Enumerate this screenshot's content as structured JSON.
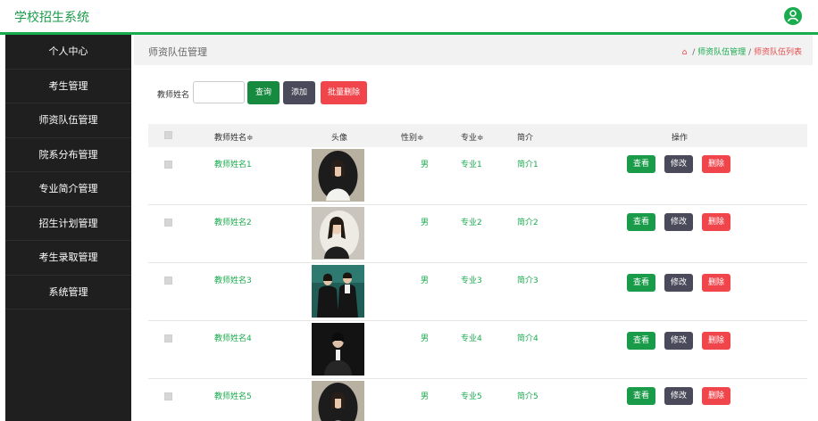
{
  "app": {
    "title": "学校招生系统"
  },
  "sidebar": {
    "items": [
      {
        "label": "个人中心"
      },
      {
        "label": "考生管理"
      },
      {
        "label": "师资队伍管理"
      },
      {
        "label": "院系分布管理"
      },
      {
        "label": "专业简介管理"
      },
      {
        "label": "招生计划管理"
      },
      {
        "label": "考生录取管理"
      },
      {
        "label": "系统管理"
      }
    ]
  },
  "header": {
    "page_title": "师资队伍管理",
    "breadcrumb": [
      "师资队伍管理",
      "师资队伍列表"
    ],
    "breadcrumb_sep": "/"
  },
  "search": {
    "label": "教师姓名",
    "value": "",
    "placeholder": "",
    "search_button": "查询",
    "add_button": "添加",
    "batch_delete_button": "批量删除"
  },
  "table": {
    "columns": {
      "name": "教师姓名≑",
      "photo": "头像",
      "gender": "性别≑",
      "major": "专业≑",
      "intro": "简介",
      "actions": "操作"
    },
    "rows": [
      {
        "name": "教师姓名1",
        "gender": "男",
        "major": "专业1",
        "intro": "简介1"
      },
      {
        "name": "教师姓名2",
        "gender": "男",
        "major": "专业2",
        "intro": "简介2"
      },
      {
        "name": "教师姓名3",
        "gender": "男",
        "major": "专业3",
        "intro": "简介3"
      },
      {
        "name": "教师姓名4",
        "gender": "男",
        "major": "专业4",
        "intro": "简介4"
      },
      {
        "name": "教师姓名5",
        "gender": "男",
        "major": "专业5",
        "intro": "简介5"
      }
    ],
    "action_labels": {
      "view": "查看",
      "edit": "修改",
      "delete": "删除"
    }
  },
  "colors": {
    "accent_green": "#1aab4e",
    "sidebar_bg": "#1f1f1f",
    "danger_red": "#f0454b",
    "neutral_dark": "#4a4a5a"
  }
}
